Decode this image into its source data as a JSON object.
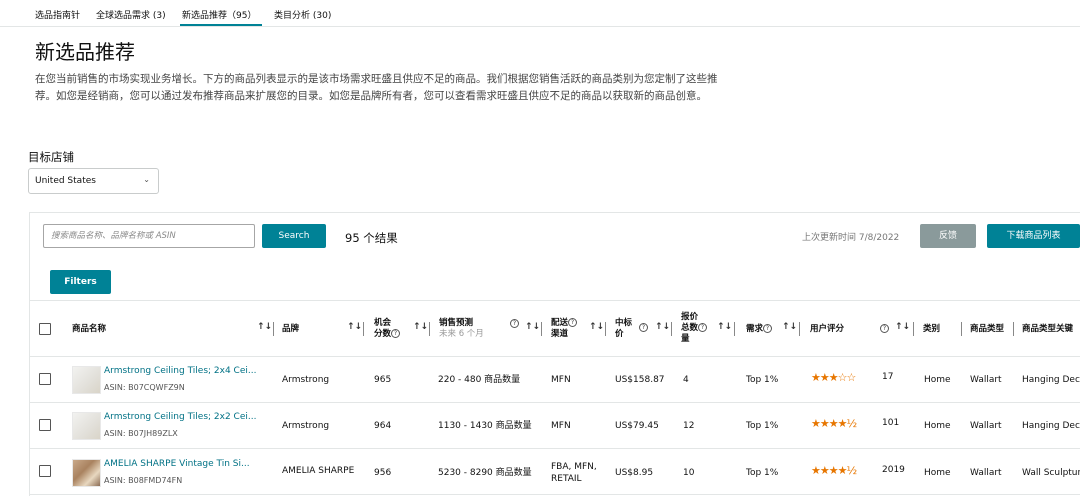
{
  "tabs": [
    {
      "label": "选品指南针"
    },
    {
      "label": "全球选品需求 (3)"
    },
    {
      "label": "新选品推荐（95）"
    },
    {
      "label": "类目分析 (30)"
    }
  ],
  "page": {
    "title": "新选品推荐",
    "description": "在您当前销售的市场实现业务增长。下方的商品列表显示的是该市场需求旺盛且供应不足的商品。我们根据您销售活跃的商品类别为您定制了这些推荐。如您是经销商，您可以通过发布推荐商品来扩展您的目录。如您是品牌所有者，您可以查看需求旺盛且供应不足的商品以获取新的商品创意。"
  },
  "store": {
    "label": "目标店铺",
    "selected": "United States",
    "chevron_icon": "chevron-down-icon"
  },
  "search": {
    "placeholder": "搜索商品名称、品牌名称或 ASIN",
    "button": "Search",
    "results": "95 个结果"
  },
  "toolbar": {
    "updated": "上次更新时间 7/8/2022",
    "feedback": "反馈",
    "download": "下载商品列表",
    "filters": "Filters"
  },
  "table": {
    "headers": {
      "name": "商品名称",
      "brand": "品牌",
      "opportunity_1": "机会",
      "opportunity_2": "分数",
      "forecast": "销售预测",
      "forecast_sub": "未来 6 个月",
      "channel_1": "配送",
      "channel_2": "渠道",
      "price_1": "中标",
      "price_2": "价",
      "offers_1": "报价",
      "offers_2": "总数",
      "offers_3": "量",
      "demand": "需求",
      "rating": "用户评分",
      "category": "类别",
      "product_type": "商品类型",
      "keyword": "商品类型关键"
    },
    "rows": [
      {
        "name": "Armstrong Ceiling Tiles; 2x4 Cei...",
        "asin": "ASIN: B07CQWFZ9N",
        "brand": "Armstrong",
        "score": "965",
        "forecast": "220 - 480 商品数量",
        "channel_1": "MFN",
        "channel_2": "",
        "price": "US$158.87",
        "offers": "4",
        "demand": "Top 1%",
        "stars": "★★★☆☆",
        "rating_value": 3,
        "ratings": "17",
        "category": "Home",
        "type": "Wallart",
        "keyword": "Hanging Deco"
      },
      {
        "name": "Armstrong Ceiling Tiles; 2x2 Cei...",
        "asin": "ASIN: B07JH89ZLX",
        "brand": "Armstrong",
        "score": "964",
        "forecast": "1130 - 1430 商品数量",
        "channel_1": "MFN",
        "channel_2": "",
        "price": "US$79.45",
        "offers": "12",
        "demand": "Top 1%",
        "stars": "★★★★½",
        "rating_value": 4.5,
        "ratings": "101",
        "category": "Home",
        "type": "Wallart",
        "keyword": "Hanging Deco"
      },
      {
        "name": "AMELIA SHARPE Vintage Tin Si...",
        "asin": "ASIN: B08FMD74FN",
        "brand": "AMELIA SHARPE",
        "score": "956",
        "forecast": "5230 - 8290 商品数量",
        "channel_1": "FBA, MFN,",
        "channel_2": "RETAIL",
        "price": "US$8.95",
        "offers": "10",
        "demand": "Top 1%",
        "stars": "★★★★½",
        "rating_value": 4.5,
        "ratings": "2019",
        "category": "Home",
        "type": "Wallart",
        "keyword": "Wall Sculptur"
      }
    ]
  },
  "colors": {
    "accent": "#008296",
    "link": "#007185",
    "star": "#e77600",
    "muted_button": "#8a9a9b"
  }
}
